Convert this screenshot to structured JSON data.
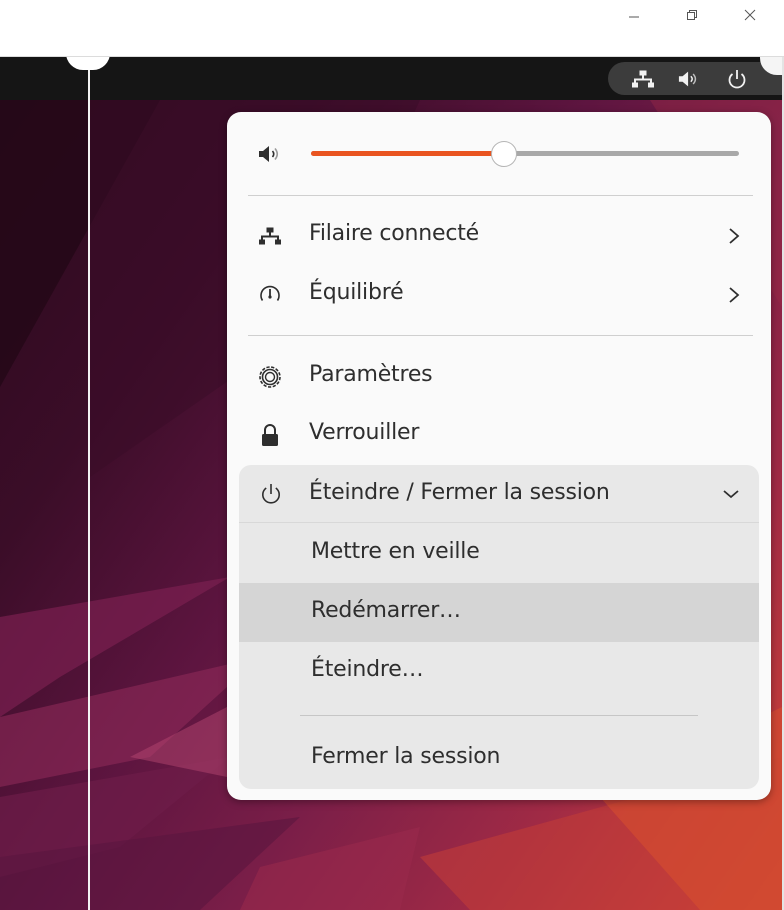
{
  "host_window": {
    "minimize_icon": "minimize-icon",
    "restore_icon": "restore-icon",
    "close_icon": "close-icon"
  },
  "top_bar": {
    "status_icons": [
      "network-wired-icon",
      "volume-icon",
      "power-icon"
    ]
  },
  "quick_settings": {
    "volume": {
      "icon": "volume-icon",
      "level": 0.45,
      "accent_color": "#e95420"
    },
    "network": {
      "icon": "network-wired-icon",
      "label": "Filaire connecté"
    },
    "power_mode": {
      "icon": "power-profile-icon",
      "label": "Équilibré"
    },
    "settings": {
      "icon": "gear-icon",
      "label": "Paramètres"
    },
    "lock": {
      "icon": "lock-icon",
      "label": "Verrouiller"
    },
    "power_menu": {
      "icon": "power-icon",
      "label": "Éteindre / Fermer la session",
      "expanded": true,
      "items": [
        {
          "label": "Mettre en veille"
        },
        {
          "label": "Redémarrer…"
        },
        {
          "label": "Éteindre…"
        },
        {
          "label": "Fermer la session"
        }
      ]
    }
  },
  "colors": {
    "menu_background": "#fafafa",
    "highlight": "#d5d5d5",
    "top_bar": "#151515"
  }
}
